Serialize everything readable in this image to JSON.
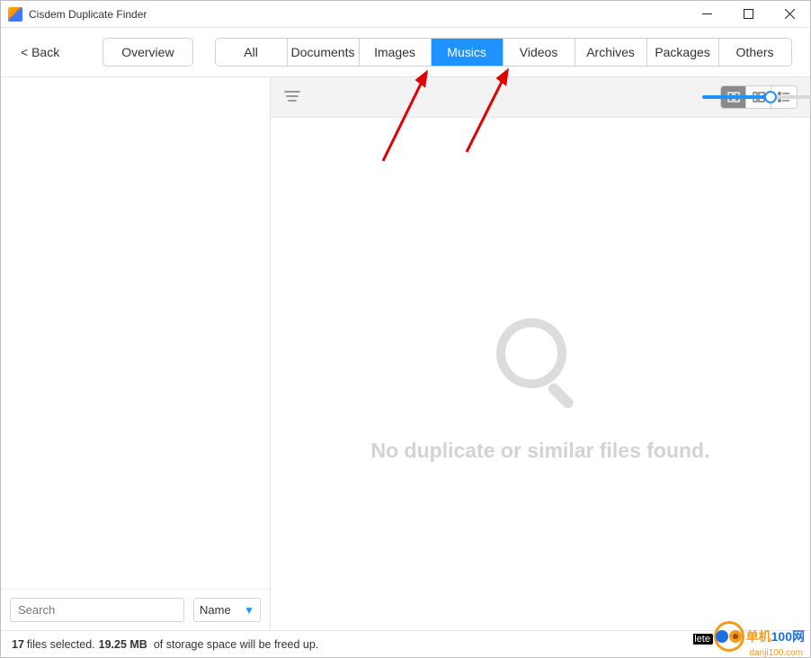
{
  "titlebar": {
    "title": "Cisdem Duplicate Finder"
  },
  "toolbar": {
    "back_label": "< Back",
    "overview_label": "Overview",
    "tabs": [
      "All",
      "Documents",
      "Images",
      "Musics",
      "Videos",
      "Archives",
      "Packages",
      "Others"
    ],
    "active_tab_index": 3
  },
  "viewbar": {
    "slider_percent": 54
  },
  "empty": {
    "message": "No duplicate or similar files found."
  },
  "sidebar": {
    "search_placeholder": "Search",
    "sort_label": "Name"
  },
  "status": {
    "files_count": "17",
    "files_text": "files selected.",
    "size": "19.25 MB",
    "size_text": "of storage space will be freed up."
  },
  "watermark": {
    "lete": "lete",
    "t1": "单机",
    "t2": "100网",
    "sub": "danji100.com"
  }
}
